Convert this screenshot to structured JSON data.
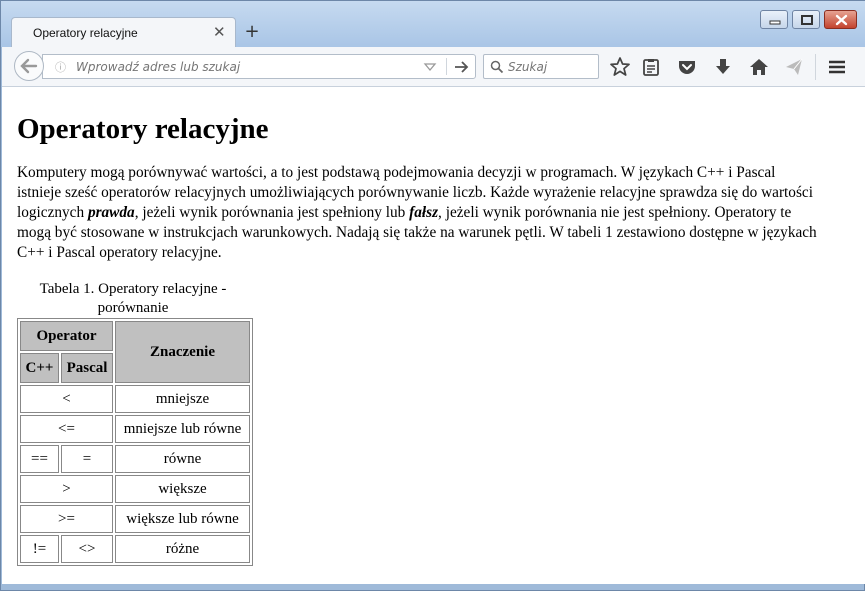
{
  "browser": {
    "tab_title": "Operatory relacyjne",
    "url_placeholder": "Wprowadź adres lub szukaj",
    "search_placeholder": "Szukaj"
  },
  "page": {
    "heading": "Operatory relacyjne",
    "intro_part1": "Komputery mogą porównywać wartości, a to jest podstawą podejmowania decyzji w programach. W językach C++ i Pascal istnieje sześć operatorów relacyjnych umożliwiających porównywanie liczb. Każde wyrażenie relacyjne sprawdza się do wartości logicznych ",
    "intro_true": "prawda",
    "intro_part2": ", jeżeli wynik porównania jest spełniony lub ",
    "intro_false": "fałsz",
    "intro_part3": ", jeżeli wynik porównania nie jest spełniony. Operatory te mogą być stosowane w instrukcjach warunkowych. Nadają się także na warunek pętli. W tabeli 1 zestawiono dostępne w językach C++ i Pascal operatory relacyjne.",
    "caption": "Tabela 1. Operatory relacyjne - porównanie"
  },
  "table": {
    "header_operator": "Operator",
    "header_cpp": "C++",
    "header_pascal": "Pascal",
    "header_meaning": "Znaczenie",
    "rows": [
      {
        "cpp": "<",
        "pascal": "",
        "meaning": "mniejsze",
        "merged": true
      },
      {
        "cpp": "<=",
        "pascal": "",
        "meaning": "mniejsze lub równe",
        "merged": true
      },
      {
        "cpp": "==",
        "pascal": "=",
        "meaning": "równe",
        "merged": false
      },
      {
        "cpp": ">",
        "pascal": "",
        "meaning": "większe",
        "merged": true
      },
      {
        "cpp": ">=",
        "pascal": "",
        "meaning": "większe lub równe",
        "merged": true
      },
      {
        "cpp": "!=",
        "pascal": "<>",
        "meaning": "różne",
        "merged": false
      }
    ]
  },
  "icons": {
    "back": "back-arrow-icon",
    "info": "info-icon",
    "history_dropdown": "chevron-down-icon",
    "go": "go-arrow-icon",
    "search": "search-icon",
    "bookmark": "star-icon",
    "reading_list": "clipboard-icon",
    "pocket": "pocket-icon",
    "downloads": "download-icon",
    "home": "home-icon",
    "share": "send-icon",
    "menu": "hamburger-menu-icon"
  }
}
